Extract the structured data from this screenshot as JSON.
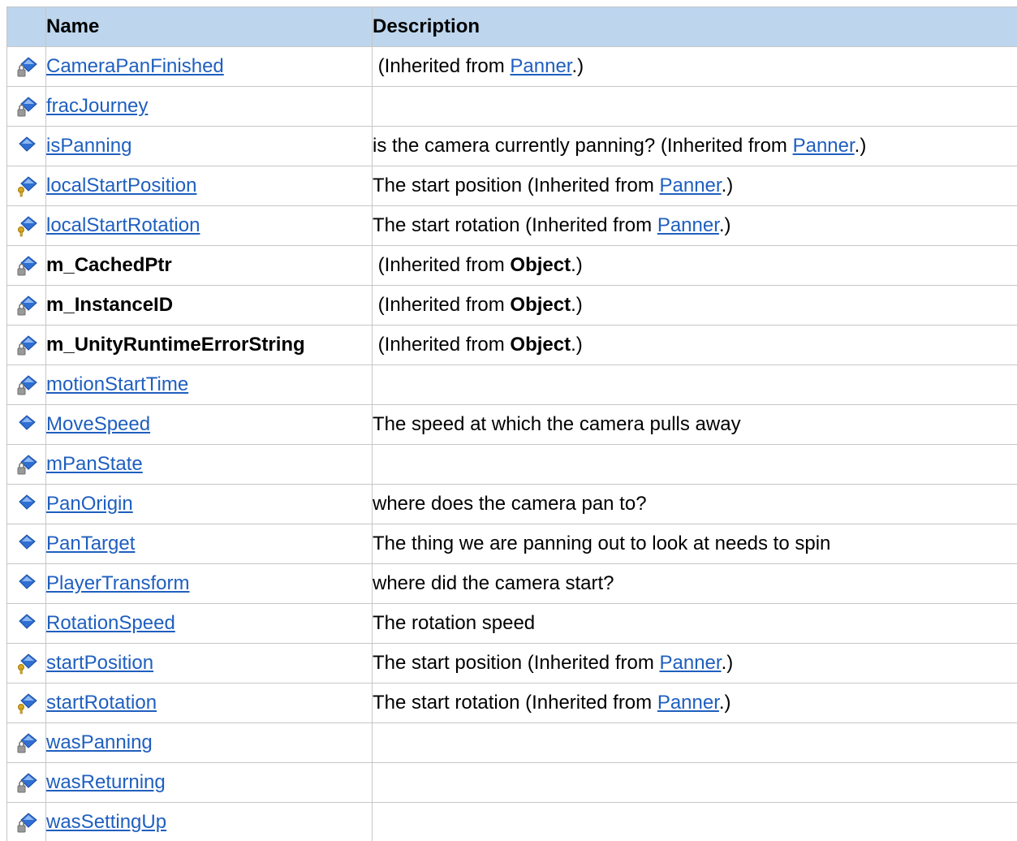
{
  "header": {
    "icon_col": "",
    "name_col": "Name",
    "description_col": "Description"
  },
  "colors": {
    "header_bg": "#bdd6ee",
    "border": "#c6c6c6",
    "link": "#1f5fbf",
    "diamond_blue": "#2f6fd4",
    "lock_gray": "#9a9a9a",
    "key_gold": "#d8a81c"
  },
  "rows": [
    {
      "icon": "private-field-icon",
      "name": "CameraPanFinished",
      "name_link": true,
      "desc": {
        "pre": " (Inherited from ",
        "ref": "Panner",
        "ref_is_link": true,
        "post": ".)"
      }
    },
    {
      "icon": "private-field-icon",
      "name": "fracJourney",
      "name_link": true,
      "desc": {
        "pre": "",
        "ref": "",
        "ref_is_link": false,
        "post": ""
      }
    },
    {
      "icon": "public-field-icon",
      "name": "isPanning",
      "name_link": true,
      "desc": {
        "pre": "is the camera currently panning? (Inherited from ",
        "ref": "Panner",
        "ref_is_link": true,
        "post": ".)"
      }
    },
    {
      "icon": "protected-field-icon",
      "name": "localStartPosition",
      "name_link": true,
      "desc": {
        "pre": "The start position (Inherited from ",
        "ref": "Panner",
        "ref_is_link": true,
        "post": ".)"
      }
    },
    {
      "icon": "protected-field-icon",
      "name": "localStartRotation",
      "name_link": true,
      "desc": {
        "pre": "The start rotation (Inherited from ",
        "ref": "Panner",
        "ref_is_link": true,
        "post": ".)"
      }
    },
    {
      "icon": "private-field-icon",
      "name": "m_CachedPtr",
      "name_link": false,
      "desc": {
        "pre": " (Inherited from ",
        "ref": "Object",
        "ref_is_link": false,
        "post": ".)"
      }
    },
    {
      "icon": "private-field-icon",
      "name": "m_InstanceID",
      "name_link": false,
      "desc": {
        "pre": " (Inherited from ",
        "ref": "Object",
        "ref_is_link": false,
        "post": ".)"
      }
    },
    {
      "icon": "private-field-icon",
      "name": "m_UnityRuntimeErrorString",
      "name_link": false,
      "desc": {
        "pre": " (Inherited from ",
        "ref": "Object",
        "ref_is_link": false,
        "post": ".)"
      }
    },
    {
      "icon": "private-field-icon",
      "name": "motionStartTime",
      "name_link": true,
      "desc": {
        "pre": "",
        "ref": "",
        "ref_is_link": false,
        "post": ""
      }
    },
    {
      "icon": "public-field-icon",
      "name": "MoveSpeed",
      "name_link": true,
      "desc": {
        "pre": "The speed at which the camera pulls away",
        "ref": "",
        "ref_is_link": false,
        "post": ""
      }
    },
    {
      "icon": "private-field-icon",
      "name": "mPanState",
      "name_link": true,
      "desc": {
        "pre": "",
        "ref": "",
        "ref_is_link": false,
        "post": ""
      }
    },
    {
      "icon": "public-field-icon",
      "name": "PanOrigin",
      "name_link": true,
      "desc": {
        "pre": "where does the camera pan to?",
        "ref": "",
        "ref_is_link": false,
        "post": ""
      }
    },
    {
      "icon": "public-field-icon",
      "name": "PanTarget",
      "name_link": true,
      "desc": {
        "pre": "The thing we are panning out to look at needs to spin",
        "ref": "",
        "ref_is_link": false,
        "post": ""
      }
    },
    {
      "icon": "public-field-icon",
      "name": "PlayerTransform",
      "name_link": true,
      "desc": {
        "pre": "where did the camera start?",
        "ref": "",
        "ref_is_link": false,
        "post": ""
      }
    },
    {
      "icon": "public-field-icon",
      "name": "RotationSpeed",
      "name_link": true,
      "desc": {
        "pre": "The rotation speed",
        "ref": "",
        "ref_is_link": false,
        "post": ""
      }
    },
    {
      "icon": "protected-field-icon",
      "name": "startPosition",
      "name_link": true,
      "desc": {
        "pre": "The start position (Inherited from ",
        "ref": "Panner",
        "ref_is_link": true,
        "post": ".)"
      }
    },
    {
      "icon": "protected-field-icon",
      "name": "startRotation",
      "name_link": true,
      "desc": {
        "pre": "The start rotation (Inherited from ",
        "ref": "Panner",
        "ref_is_link": true,
        "post": ".)"
      }
    },
    {
      "icon": "private-field-icon",
      "name": "wasPanning",
      "name_link": true,
      "desc": {
        "pre": "",
        "ref": "",
        "ref_is_link": false,
        "post": ""
      }
    },
    {
      "icon": "private-field-icon",
      "name": "wasReturning",
      "name_link": true,
      "desc": {
        "pre": "",
        "ref": "",
        "ref_is_link": false,
        "post": ""
      }
    },
    {
      "icon": "private-field-icon",
      "name": "wasSettingUp",
      "name_link": true,
      "desc": {
        "pre": "",
        "ref": "",
        "ref_is_link": false,
        "post": ""
      }
    }
  ]
}
